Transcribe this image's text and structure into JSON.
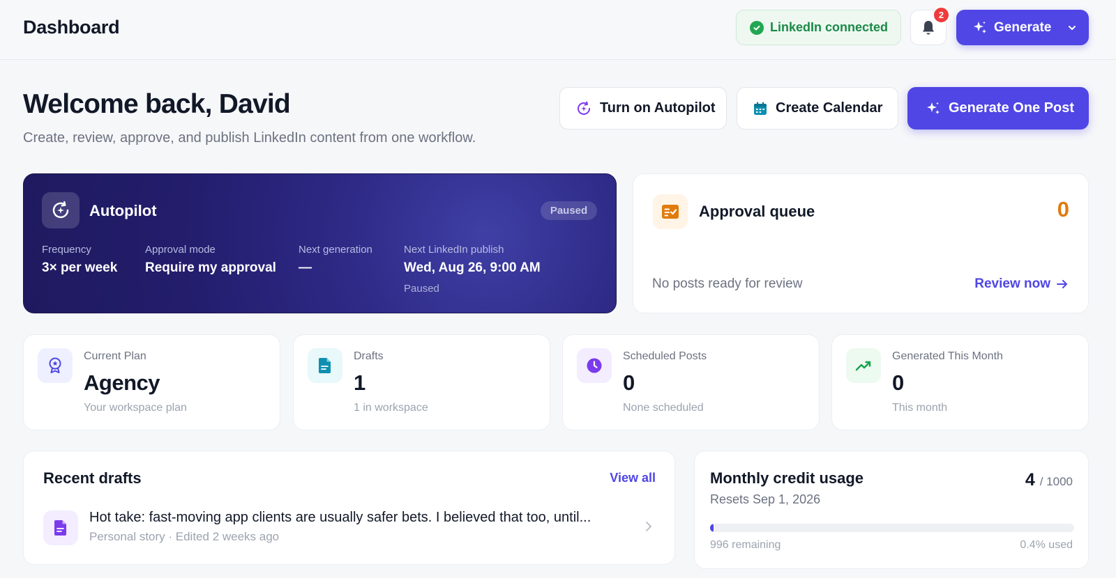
{
  "header": {
    "title": "Dashboard",
    "linkedin_status": "LinkedIn connected",
    "notification_count": "2",
    "generate_label": "Generate"
  },
  "welcome": {
    "heading": "Welcome back, David",
    "subtitle": "Create, review, approve, and publish LinkedIn content from one workflow."
  },
  "actions": {
    "autopilot_label": "Turn on Autopilot",
    "calendar_label": "Create Calendar",
    "one_post_label": "Generate One Post"
  },
  "autopilot": {
    "title": "Autopilot",
    "status": "Paused",
    "fields": [
      {
        "label": "Frequency",
        "value": "3× per week"
      },
      {
        "label": "Approval mode",
        "value": "Require my approval"
      },
      {
        "label": "Next generation",
        "value": "—"
      },
      {
        "label": "Next LinkedIn publish",
        "value": "Wed, Aug 26, 9:00 AM",
        "note": "Paused"
      }
    ]
  },
  "approval_queue": {
    "title": "Approval queue",
    "count": "0",
    "empty_text": "No posts ready for review",
    "link_label": "Review now"
  },
  "stats": [
    {
      "label": "Current Plan",
      "value": "Agency",
      "sub": "Your workspace plan",
      "icon": "award-icon",
      "color": "#4f46e5",
      "bg": "#eef0ff"
    },
    {
      "label": "Drafts",
      "value": "1",
      "sub": "1 in workspace",
      "icon": "document-icon",
      "color": "#0e8fb0",
      "bg": "#e8f8fb"
    },
    {
      "label": "Scheduled Posts",
      "value": "0",
      "sub": "None scheduled",
      "icon": "clock-icon",
      "color": "#7c3aed",
      "bg": "#f3edff"
    },
    {
      "label": "Generated This Month",
      "value": "0",
      "sub": "This month",
      "icon": "trending-up-icon",
      "color": "#16a34a",
      "bg": "#ecfaf0"
    }
  ],
  "recent_drafts": {
    "title": "Recent drafts",
    "view_all": "View all",
    "items": [
      {
        "title": "Hot take: fast-moving app clients are usually safer bets. I believed that too, until...",
        "meta": "Personal story · Edited 2 weeks ago"
      }
    ]
  },
  "credit_usage": {
    "title": "Monthly credit usage",
    "resets": "Resets Sep 1, 2026",
    "used": "4",
    "total": "/ 1000",
    "used_fraction": 0.004,
    "remaining": "996 remaining",
    "percent_used": "0.4% used"
  },
  "colors": {
    "accent": "#4f46e5",
    "success": "#22a652",
    "warning": "#e07b0c",
    "badge": "#ef3b3b"
  }
}
